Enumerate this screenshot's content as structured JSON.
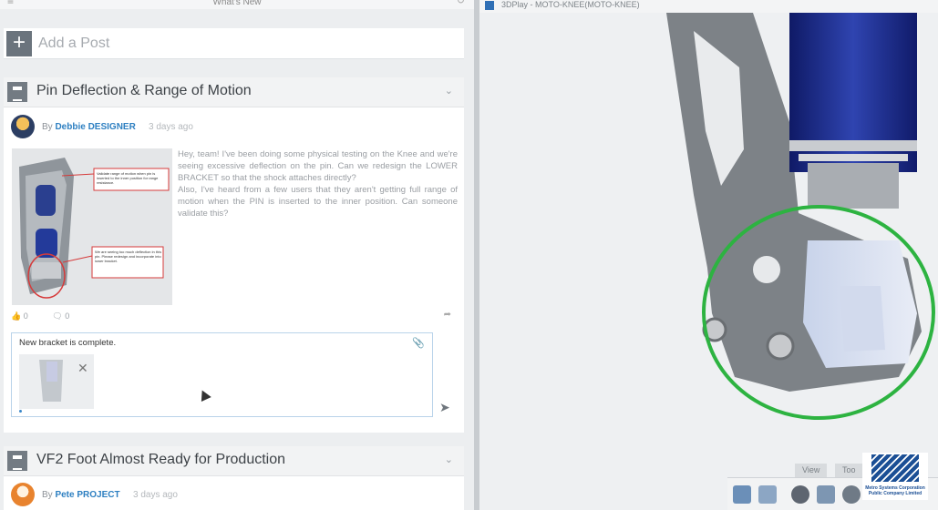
{
  "feed": {
    "header_title": "What's New",
    "add_post_placeholder": "Add a Post"
  },
  "posts": [
    {
      "title": "Pin Deflection & Range of Motion",
      "by": "By",
      "author": "Debbie DESIGNER",
      "time": "3 days ago",
      "body": "Hey, team! I've been doing some physical testing on the Knee and we're seeing excessive deflection on the pin. Can we redesign the LOWER BRACKET so that the shock attaches directly?\nAlso, I've heard from a few users that they aren't getting full range of motion when the PIN is inserted to the inner position. Can someone validate this?",
      "callout_1": "Validate range of motion when pin is inserted to the inner position for range resistance.",
      "callout_2": "We are seeing too much deflection in this pin. Please redesign and incorporate into lower bracket.",
      "likes": "0",
      "comments": "0",
      "comment_draft": "New  bracket is complete."
    },
    {
      "title": "VF2 Foot Almost Ready for Production",
      "by": "By",
      "author": "Pete PROJECT",
      "time": "3 days ago"
    }
  ],
  "viewer": {
    "title": "3DPlay - MOTO-KNEE(MOTO-KNEE)",
    "tabs": [
      "View",
      "Too"
    ],
    "accent_ring": "#2db341",
    "shock_color": "#1f2e8f"
  },
  "brand": {
    "line1": "Metro Systems Corporation",
    "line2": "Public Company Limited"
  }
}
